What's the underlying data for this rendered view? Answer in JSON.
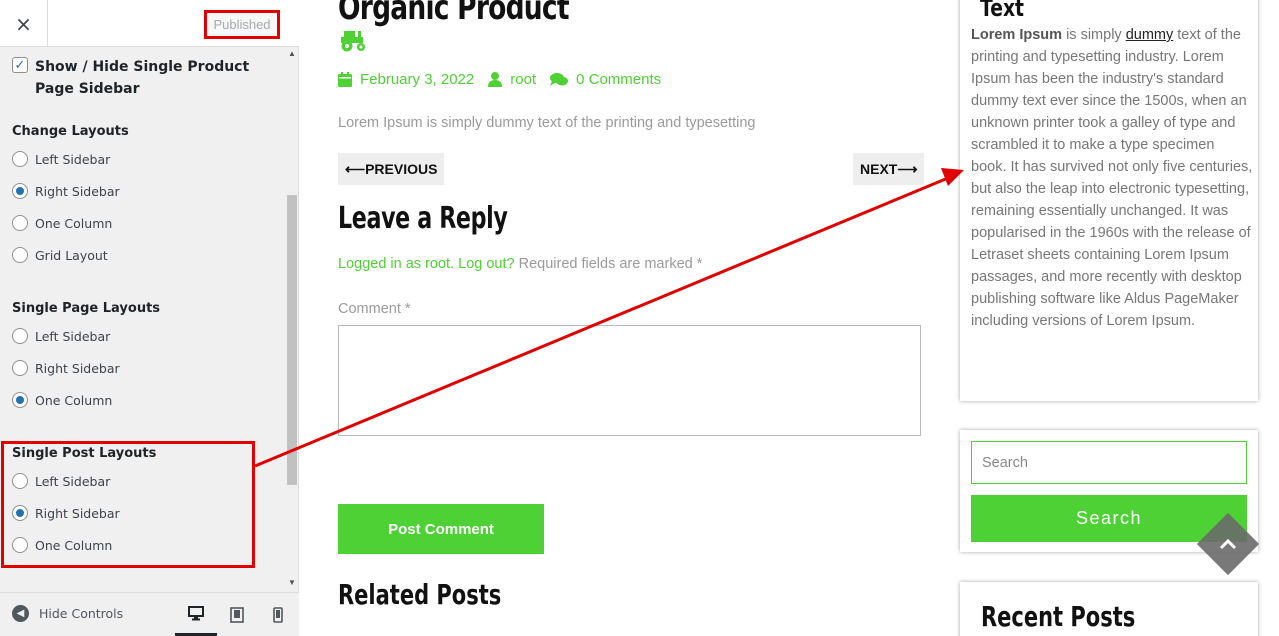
{
  "panel": {
    "close_icon": "×",
    "published_label": "Published",
    "checkbox_label": "Show / Hide Single Product Page Sidebar",
    "change_layouts": {
      "title": "Change Layouts",
      "options": [
        "Left Sidebar",
        "Right Sidebar",
        "One Column",
        "Grid Layout"
      ],
      "selected": "Right Sidebar"
    },
    "single_page_layouts": {
      "title": "Single Page Layouts",
      "options": [
        "Left Sidebar",
        "Right Sidebar",
        "One Column"
      ],
      "selected": "One Column"
    },
    "single_post_layouts": {
      "title": "Single Post Layouts",
      "options": [
        "Left Sidebar",
        "Right Sidebar",
        "One Column"
      ],
      "selected": "Right Sidebar"
    },
    "footer": {
      "hide_controls_label": "Hide Controls",
      "devices": [
        "desktop-icon",
        "tablet-icon",
        "mobile-icon"
      ],
      "active_device": "desktop-icon"
    }
  },
  "preview": {
    "post_title": "Organic Product",
    "meta": {
      "date": "February 3, 2022",
      "author": "root",
      "comments": "0 Comments"
    },
    "excerpt": "Lorem Ipsum is simply dummy text of the printing and typesetting",
    "prev_label": "PREVIOUS",
    "next_label": "NEXT",
    "prev_arrow": "⟵",
    "next_arrow": "⟶",
    "reply_title": "Leave a Reply",
    "logged_in_link": "Logged in as root.",
    "logout_link": "Log out?",
    "required_note": "Required fields are marked *",
    "comment_label": "Comment *",
    "post_comment_label": "Post Comment",
    "related_title": "Related Posts",
    "text_widget": {
      "title": "Text",
      "bold_lead": "Lorem Ipsum",
      "before_link": " is simply ",
      "link": "dummy",
      "rest": " text of the printing and typesetting industry. Lorem Ipsum has been the industry's standard dummy text ever since the 1500s, when an unknown printer took a galley of type and scrambled it to make a type specimen book. It has survived not only five centuries, but also the leap into electronic typesetting, remaining essentially unchanged. It was popularised in the 1960s with the release of Letraset sheets containing Lorem Ipsum passages, and more recently with desktop publishing software like Aldus PageMaker including versions of Lorem Ipsum."
    },
    "search_placeholder": "Search",
    "search_button": "Search",
    "recent_title": "Recent Posts"
  },
  "colors": {
    "accent_green": "#4ed134",
    "annotation_red": "#e00000",
    "wp_blue": "#2271b1"
  }
}
